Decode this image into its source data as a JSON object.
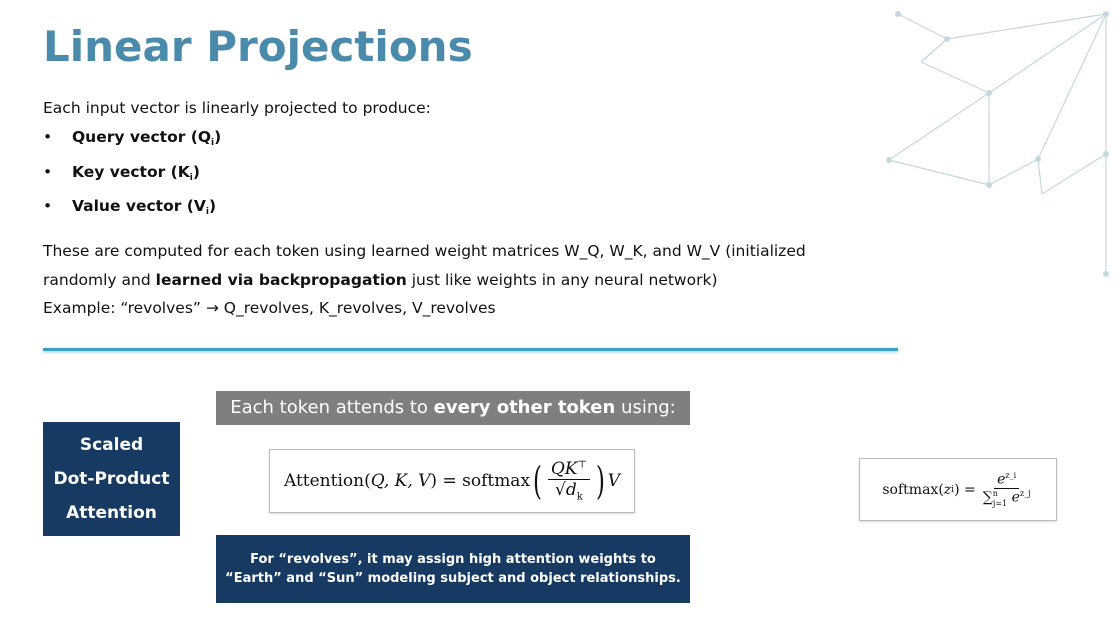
{
  "title": "Linear Projections",
  "intro": "Each input vector is linearly projected to produce:",
  "bullets": [
    {
      "marker": "•",
      "label": "Query vector (Q",
      "sub": "i",
      "close": ")"
    },
    {
      "marker": "•",
      "label": "Key vector (K",
      "sub": "i",
      "close": ")"
    },
    {
      "marker": "•",
      "label": "Value vector (V",
      "sub": "i",
      "close": ")"
    }
  ],
  "paragraph": {
    "part1": "These are computed for each token using learned weight matrices W_Q, W_K, and W_V (initialized randomly and ",
    "bold": "learned via backpropagation",
    "part2": " just like weights in any neural network)",
    "example": "Example: “revolves” → Q_revolves, K_revolves, V_revolves"
  },
  "sdpa_box": {
    "line1": "Scaled",
    "line2": "Dot-Product",
    "line3": "Attention"
  },
  "attends_banner": {
    "pre": "Each token attends to ",
    "bold": "every other token",
    "post": " using:"
  },
  "attention_formula": {
    "lhs": "Attention(",
    "args": "Q, K, V",
    "eq": ") = softmax",
    "numerator": "QK",
    "transpose": "⊤",
    "denominator": "√d",
    "denominator_sub": "k",
    "tail": "V"
  },
  "softmax_formula": {
    "lhs": "softmax(",
    "arg": "z",
    "arg_sub": "i",
    "eq": ") =",
    "numerator": "e",
    "numerator_sup": "z_i",
    "denominator_sum": "∑",
    "sum_sub": "j=1",
    "sum_sup": "n",
    "denominator": "e",
    "denominator_sup": "z_j"
  },
  "note": "For “revolves”, it may assign high attention weights to “Earth” and “Sun” modeling subject and object relationships.",
  "colors": {
    "title": "#4a8aab",
    "navy": "#173a63",
    "banner_gray": "#7f7f7f",
    "rule": "#3aa0c4",
    "network": "#c5d8de"
  }
}
